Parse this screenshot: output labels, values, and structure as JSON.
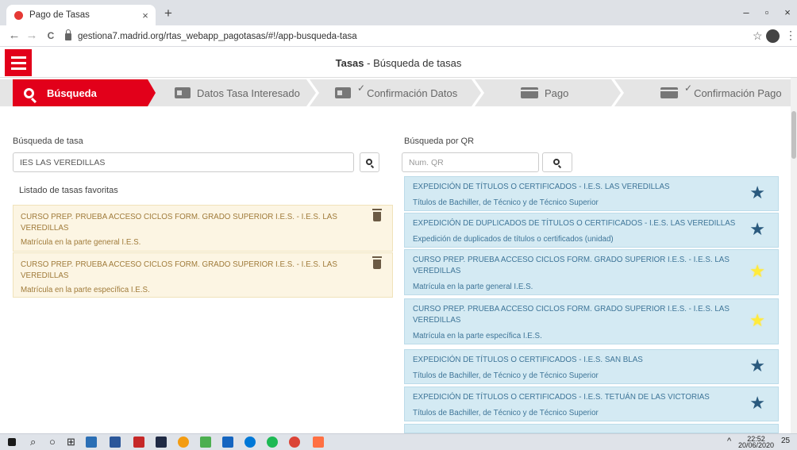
{
  "browser": {
    "tab_title": "Pago de Tasas",
    "tab_close": "×",
    "new_tab": "+",
    "url": "gestiona7.madrid.org/rtas_webapp_pagotasas/#!/app-busqueda-tasa",
    "minimize": "–",
    "maximize": "▫",
    "close": "×",
    "back": "←",
    "forward": "→",
    "reload": "C",
    "bookmark": "☆",
    "menu": "⋮"
  },
  "app": {
    "title_bold": "Tasas",
    "title_rest": " - Búsqueda de tasas"
  },
  "steps": [
    {
      "label": "Búsqueda"
    },
    {
      "label": "Datos Tasa Interesado"
    },
    {
      "label": "Confirmación Datos"
    },
    {
      "label": "Pago"
    },
    {
      "label": "Confirmación Pago"
    }
  ],
  "left": {
    "search_label": "Búsqueda de tasa",
    "search_value": "IES LAS VEREDILLAS",
    "favorites_title": "Listado de tasas favoritas",
    "favorites": [
      {
        "title": "CURSO PREP. PRUEBA ACCESO CICLOS FORM. GRADO SUPERIOR I.E.S. - I.E.S. LAS VEREDILLAS",
        "sub": "Matrícula en la parte general I.E.S."
      },
      {
        "title": "CURSO PREP. PRUEBA ACCESO CICLOS FORM. GRADO SUPERIOR I.E.S. - I.E.S. LAS VEREDILLAS",
        "sub": "Matrícula en la parte específica I.E.S."
      }
    ]
  },
  "right": {
    "qr_label": "Búsqueda por QR",
    "qr_placeholder": "Num. QR",
    "results": [
      {
        "title": "EXPEDICIÓN DE TÍTULOS O CERTIFICADOS - I.E.S. LAS VEREDILLAS",
        "sub": "Títulos de Bachiller, de Técnico y de Técnico Superior",
        "favorite": false
      },
      {
        "title": "EXPEDICIÓN DE DUPLICADOS DE TÍTULOS O CERTIFICADOS - I.E.S. LAS VEREDILLAS",
        "sub": "Expedición de duplicados de títulos o certificados (unidad)",
        "favorite": false
      },
      {
        "title": "CURSO PREP. PRUEBA ACCESO CICLOS FORM. GRADO SUPERIOR I.E.S. - I.E.S. LAS VEREDILLAS",
        "sub": "Matrícula en la parte general I.E.S.",
        "favorite": true
      },
      {
        "title": "CURSO PREP. PRUEBA ACCESO CICLOS FORM. GRADO SUPERIOR I.E.S. - I.E.S. LAS VEREDILLAS",
        "sub": "Matrícula en la parte específica I.E.S.",
        "favorite": true
      },
      {
        "title": "EXPEDICIÓN DE TÍTULOS O CERTIFICADOS - I.E.S. SAN BLAS",
        "sub": "Títulos de Bachiller, de Técnico y de Técnico Superior",
        "favorite": false
      },
      {
        "title": "EXPEDICIÓN DE TÍTULOS O CERTIFICADOS - I.E.S. TETUÁN DE LAS VICTORIAS",
        "sub": "Títulos de Bachiller, de Técnico y de Técnico Superior",
        "favorite": false
      }
    ],
    "star_glyph": "★"
  },
  "taskbar": {
    "time": "22:52",
    "date": "20/06/2020",
    "notifications": "25"
  },
  "colors": {
    "brand_red": "#e2001a",
    "result_bg": "#d4eaf3",
    "favorite_bg": "#fcf5e3",
    "star_favorite": "#ffeb3b",
    "star_default": "#2a5a7e"
  }
}
